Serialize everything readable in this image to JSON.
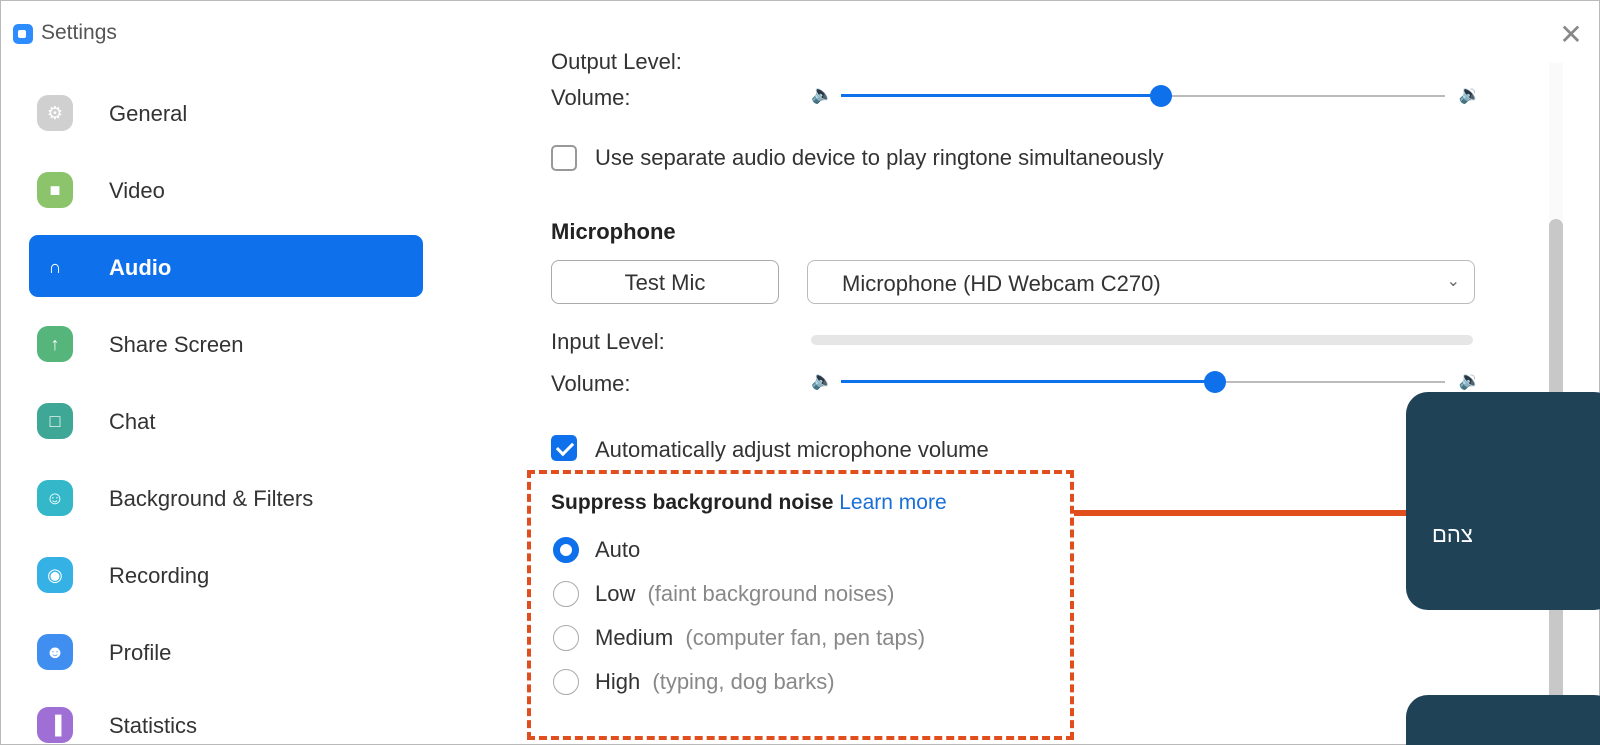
{
  "window": {
    "title": "Settings",
    "close_glyph": "✕"
  },
  "sidebar": {
    "items": [
      {
        "label": "General",
        "icon": "gear-icon",
        "color": "#d0d0d0",
        "glyph": "⚙"
      },
      {
        "label": "Video",
        "icon": "video-camera-icon",
        "color": "#8cc46b",
        "glyph": "■"
      },
      {
        "label": "Audio",
        "icon": "headphones-icon",
        "color": "#0e71eb",
        "glyph": "∩",
        "active": true
      },
      {
        "label": "Share Screen",
        "icon": "share-screen-icon",
        "color": "#55b57a",
        "glyph": "↑"
      },
      {
        "label": "Chat",
        "icon": "chat-bubble-icon",
        "color": "#3fa796",
        "glyph": "□"
      },
      {
        "label": "Background & Filters",
        "icon": "person-frame-icon",
        "color": "#34b8c9",
        "glyph": "☺"
      },
      {
        "label": "Recording",
        "icon": "record-icon",
        "color": "#35b1e5",
        "glyph": "◉"
      },
      {
        "label": "Profile",
        "icon": "profile-icon",
        "color": "#3f8ef0",
        "glyph": "☻"
      },
      {
        "label": "Statistics",
        "icon": "statistics-icon",
        "color": "#9f6fd6",
        "glyph": "▐"
      }
    ]
  },
  "speaker": {
    "output_level_label": "Output Level:",
    "volume_label": "Volume:",
    "volume_fraction": 0.53,
    "separate_device_label": "Use separate audio device to play ringtone simultaneously",
    "separate_device_checked": false
  },
  "microphone": {
    "heading": "Microphone",
    "test_button": "Test Mic",
    "device": "Microphone (HD Webcam C270)",
    "input_level_label": "Input Level:",
    "volume_label": "Volume:",
    "volume_fraction": 0.62,
    "auto_adjust_label": "Automatically adjust microphone volume",
    "auto_adjust_checked": true
  },
  "noise": {
    "heading": "Suppress background noise",
    "learn_more": "Learn more",
    "options": [
      {
        "label": "Auto",
        "hint": "",
        "selected": true
      },
      {
        "label": "Low",
        "hint": "(faint background noises)",
        "selected": false
      },
      {
        "label": "Medium",
        "hint": "(computer fan, pen taps)",
        "selected": false
      },
      {
        "label": "High",
        "hint": "(typing, dog barks)",
        "selected": false
      }
    ]
  },
  "callout": {
    "text": "צהם"
  },
  "colors": {
    "accent": "#0e71eb",
    "highlight": "#e04e1e",
    "callout_bg": "#1f4257"
  }
}
